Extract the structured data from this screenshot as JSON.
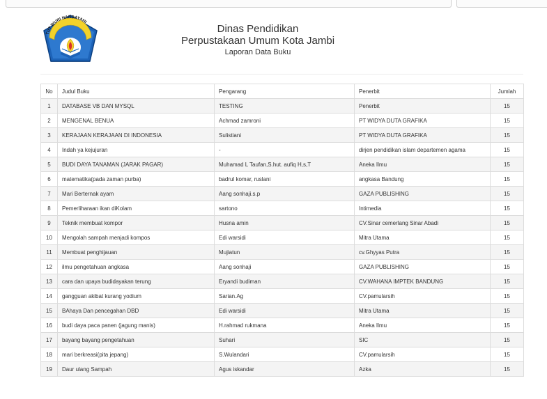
{
  "header": {
    "logo_text": "TUT WURI HANDAYANI",
    "office": "Dinas Pendidikan",
    "library": "Perpustakaan Umum Kota Jambi",
    "report_title": "Laporan Data Buku"
  },
  "table": {
    "columns": {
      "no": "No",
      "title": "Judul Buku",
      "author": "Pengarang",
      "publisher": "Penerbit",
      "qty": "Jumlah"
    },
    "rows": [
      {
        "no": "1",
        "title": "DATABASE VB DAN MYSQL",
        "author": "TESTING",
        "publisher": "Penerbit",
        "qty": "15"
      },
      {
        "no": "2",
        "title": "MENGENAL BENUA",
        "author": "Achmad zamroni",
        "publisher": "PT WIDYA DUTA GRAFIKA",
        "qty": "15"
      },
      {
        "no": "3",
        "title": "KERAJAAN KERAJAAN DI INDONESIA",
        "author": "Sulistiani",
        "publisher": "PT WIDYA DUTA GRAFIKA",
        "qty": "15"
      },
      {
        "no": "4",
        "title": "Indah ya kejujuran",
        "author": "-",
        "publisher": "dirjen pendidikan islam departemen agama",
        "qty": "15"
      },
      {
        "no": "5",
        "title": "BUDI DAYA TANAMAN (JARAK PAGAR)",
        "author": "Muhamad L Taufan,S.hut. aufiq H,s,T",
        "publisher": "Aneka Ilmu",
        "qty": "15"
      },
      {
        "no": "6",
        "title": "matematika(pada zaman purba)",
        "author": "badrul komar, ruslani",
        "publisher": "angkasa Bandung",
        "qty": "15"
      },
      {
        "no": "7",
        "title": "Mari Berternak ayam",
        "author": "Aang sonhaji.s.p",
        "publisher": "GAZA PUBLISHING",
        "qty": "15"
      },
      {
        "no": "8",
        "title": "Pemerliharaan ikan diKolam",
        "author": "sartono",
        "publisher": "Intimedia",
        "qty": "15"
      },
      {
        "no": "9",
        "title": "Teknik membuat kompor",
        "author": "Husna amin",
        "publisher": "CV.Sinar cemerlang Sinar Abadi",
        "qty": "15"
      },
      {
        "no": "10",
        "title": "Mengolah sampah menjadi kompos",
        "author": "Edi warsidi",
        "publisher": "Mitra Utama",
        "qty": "15"
      },
      {
        "no": "11",
        "title": "Membuat penghijauan",
        "author": "Mujiatun",
        "publisher": "cv.Ghyyas Putra",
        "qty": "15"
      },
      {
        "no": "12",
        "title": "ilmu pengetahuan angkasa",
        "author": "Aang sonhaji",
        "publisher": "GAZA PUBLISHING",
        "qty": "15"
      },
      {
        "no": "13",
        "title": "cara dan upaya budidayakan terung",
        "author": "Eryandi budiman",
        "publisher": "CV.WAHANA IMPTEK BANDUNG",
        "qty": "15"
      },
      {
        "no": "14",
        "title": "gangguan akibat kurang yodium",
        "author": "Sarian.Ag",
        "publisher": "CV.pamularsih",
        "qty": "15"
      },
      {
        "no": "15",
        "title": "BAhaya Dan pencegahan DBD",
        "author": "Edi warsidi",
        "publisher": "Mitra Utama",
        "qty": "15"
      },
      {
        "no": "16",
        "title": "budi daya paca panen (jagung manis)",
        "author": "H.rahmad rukmana",
        "publisher": "Aneka Ilmu",
        "qty": "15"
      },
      {
        "no": "17",
        "title": "bayang bayang pengetahuan",
        "author": "Suhari",
        "publisher": "SIC",
        "qty": "15"
      },
      {
        "no": "18",
        "title": "mari berkreasi(pita jepang)",
        "author": "S.Wulandari",
        "publisher": "CV.pamularsih",
        "qty": "15"
      },
      {
        "no": "19",
        "title": "Daur ulang Sampah",
        "author": "Agus iskandar",
        "publisher": "Azka",
        "qty": "15"
      }
    ]
  }
}
